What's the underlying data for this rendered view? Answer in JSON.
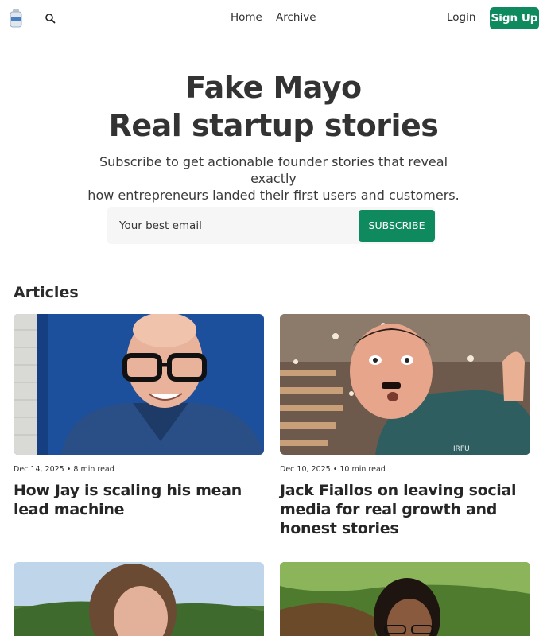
{
  "nav": {
    "logo_icon": "bottle-logo-icon",
    "search_icon": "search-icon",
    "links": [
      "Home",
      "Archive"
    ],
    "login": "Login",
    "signup": "Sign Up"
  },
  "hero": {
    "title_line1": "Fake Mayo",
    "title_line2": "Real startup stories",
    "subtitle_line1": "Subscribe to get actionable founder stories that reveal exactly",
    "subtitle_line2": "how entrepreneurs landed their first users and customers.",
    "email_placeholder": "Your best email",
    "subscribe_label": "SUBSCRIBE"
  },
  "articles": {
    "heading": "Articles",
    "items": [
      {
        "date": "Dec 14, 2025",
        "read": "8 min read",
        "title_line1": "How Jay is scaling his mean",
        "title_line2": "lead machine",
        "title_line3": ""
      },
      {
        "date": "Dec 10, 2025",
        "read": "10 min read",
        "title_line1": "Jack Fiallos on leaving social",
        "title_line2": "media for real growth and",
        "title_line3": "honest stories"
      }
    ]
  },
  "colors": {
    "accent": "#0f8a5f",
    "text": "#2b2b2b",
    "form_bg": "#f6f6f6"
  }
}
